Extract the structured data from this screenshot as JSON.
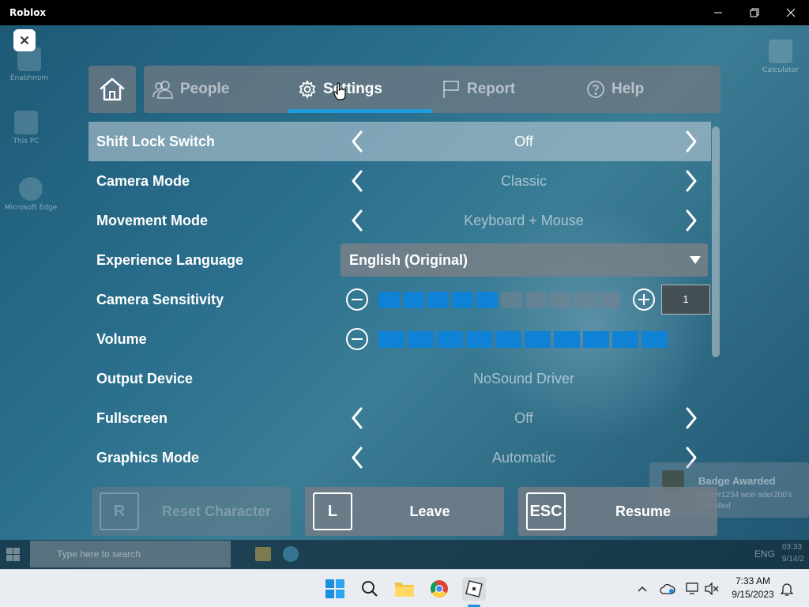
{
  "window": {
    "title": "Roblox"
  },
  "desktop_icons": [
    {
      "label": "Enabhnom"
    },
    {
      "label": "This PC"
    },
    {
      "label": "Microsoft Edge"
    },
    {
      "label": "Calculator"
    }
  ],
  "tabs": [
    {
      "label": "People",
      "icon": "people-icon",
      "active": false
    },
    {
      "label": "Settings",
      "icon": "gear-icon",
      "active": true
    },
    {
      "label": "Report",
      "icon": "flag-icon",
      "active": false
    },
    {
      "label": "Help",
      "icon": "question-icon",
      "active": false
    }
  ],
  "settings": {
    "shift_lock": {
      "label": "Shift Lock Switch",
      "value": "Off"
    },
    "camera_mode": {
      "label": "Camera Mode",
      "value": "Classic"
    },
    "movement_mode": {
      "label": "Movement Mode",
      "value": "Keyboard + Mouse"
    },
    "language": {
      "label": "Experience Language",
      "value": "English (Original)"
    },
    "camera_sensitivity": {
      "label": "Camera Sensitivity",
      "value": "1",
      "filled_steps": 5,
      "total_steps": 10
    },
    "volume": {
      "label": "Volume",
      "filled_steps": 10,
      "total_steps": 10
    },
    "output_device": {
      "label": "Output Device",
      "value": "NoSound Driver"
    },
    "fullscreen": {
      "label": "Fullscreen",
      "value": "Off"
    },
    "graphics_mode": {
      "label": "Graphics Mode",
      "value": "Automatic"
    }
  },
  "buttons": {
    "reset": {
      "key": "R",
      "label": "Reset Character"
    },
    "leave": {
      "key": "L",
      "label": "Leave"
    },
    "resume": {
      "key": "ESC",
      "label": "Resume"
    }
  },
  "badge": {
    "title": "Badge Awarded",
    "text": "burger1234 won ader200's \"Installed"
  },
  "inner_taskbar": {
    "search_placeholder": "Type here to search",
    "lang": "ENG",
    "time": "03:33",
    "date": "9/14/2"
  },
  "taskbar": {
    "time": "7:33 AM",
    "date": "9/15/2023"
  },
  "colors": {
    "accent": "#1f9bde",
    "step_on": "#0f82d6"
  }
}
